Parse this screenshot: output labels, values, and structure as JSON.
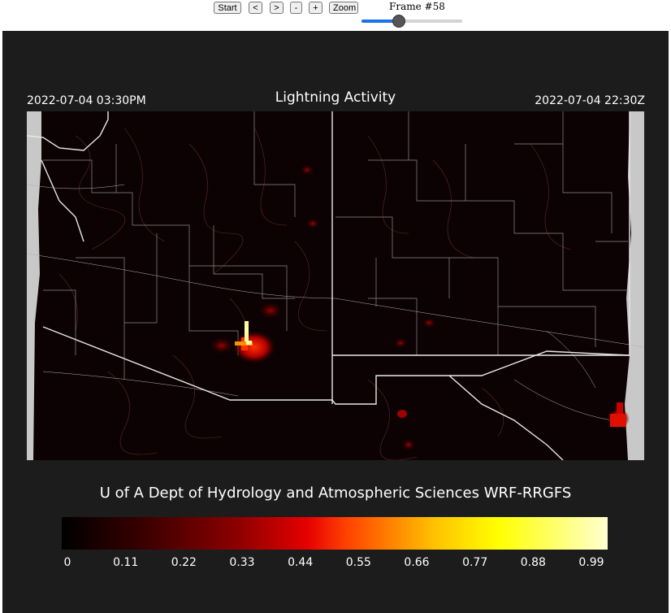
{
  "controls": {
    "start_label": "Start",
    "prev_label": "<",
    "next_label": ">",
    "minus_label": "-",
    "plus_label": "+",
    "zoom_label": "Zoom",
    "frame_label": "Frame #58",
    "slider_fraction": 0.37
  },
  "figure": {
    "title": "Lightning Activity",
    "local_time": "2022-07-04 03:30PM",
    "utc_time": "2022-07-04 22:30Z",
    "credit": "U of A Dept of Hydrology and Atmospheric Sciences WRF-RRGFS"
  },
  "colorbar": {
    "ticks": [
      "0",
      "0.11",
      "0.22",
      "0.33",
      "0.44",
      "0.55",
      "0.66",
      "0.77",
      "0.88",
      "0.99"
    ],
    "colors": [
      "#000000",
      "#8b0000",
      "#ff0000",
      "#ffff00",
      "#ffffd0"
    ]
  }
}
